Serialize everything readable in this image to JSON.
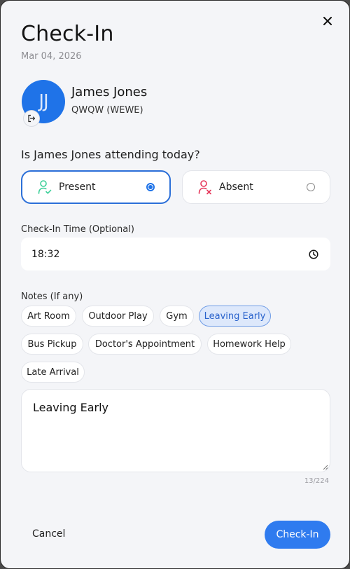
{
  "modal": {
    "title": "Check-In",
    "date": "Mar 04, 2026",
    "close_icon": "close-icon"
  },
  "student": {
    "initials": "JJ",
    "name": "James Jones",
    "subtitle": "QWQW (WEWE)",
    "badge_icon": "logout-icon",
    "avatar_color": "#1f73e8"
  },
  "attendance": {
    "question": "Is James Jones attending today?",
    "options": [
      {
        "label": "Present",
        "icon": "user-check-icon",
        "selected": true,
        "icon_color": "#3bcf98"
      },
      {
        "label": "Absent",
        "icon": "user-x-icon",
        "selected": false,
        "icon_color": "#e5375a"
      }
    ]
  },
  "check_in_time": {
    "label": "Check-In Time (Optional)",
    "value": "18:32",
    "icon": "clock-icon"
  },
  "notes": {
    "label": "Notes (If any)",
    "chips": [
      {
        "label": "Art Room",
        "selected": false
      },
      {
        "label": "Outdoor Play",
        "selected": false
      },
      {
        "label": "Gym",
        "selected": false
      },
      {
        "label": "Leaving Early",
        "selected": true
      },
      {
        "label": "Bus Pickup",
        "selected": false
      },
      {
        "label": "Doctor's Appointment",
        "selected": false
      },
      {
        "label": "Homework Help",
        "selected": false
      },
      {
        "label": "Late Arrival",
        "selected": false
      }
    ],
    "text": "Leaving Early",
    "counter": "13/224"
  },
  "actions": {
    "cancel_label": "Cancel",
    "submit_label": "Check-In",
    "accent": "#2f7bef"
  }
}
